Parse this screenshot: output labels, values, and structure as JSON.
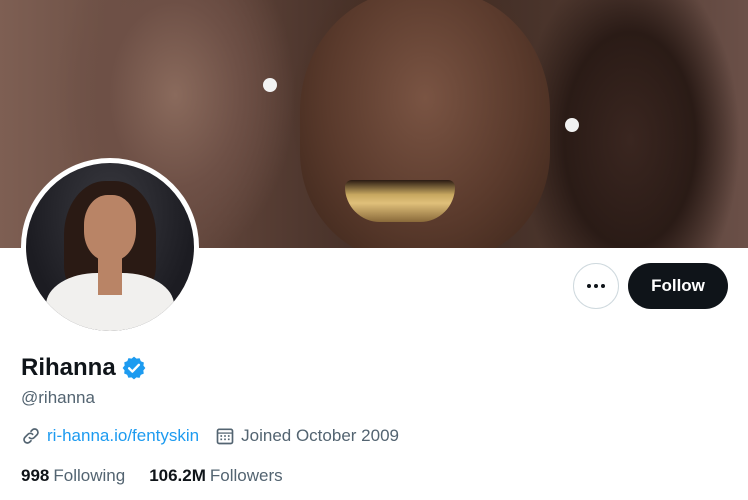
{
  "profile": {
    "display_name": "Rihanna",
    "handle": "@rihanna",
    "verified": true,
    "website": "ri-hanna.io/fentyskin",
    "joined": "Joined October 2009"
  },
  "stats": {
    "following_count": "998",
    "following_label": "Following",
    "followers_count": "106.2M",
    "followers_label": "Followers"
  },
  "actions": {
    "follow_label": "Follow"
  },
  "icons": {
    "more": "more-icon",
    "verified": "verified-badge-icon",
    "link": "link-icon",
    "calendar": "calendar-icon"
  },
  "colors": {
    "follow_button_bg": "#0f1419",
    "link": "#1d9bf0",
    "verified": "#1d9bf0",
    "secondary_text": "#536471"
  }
}
